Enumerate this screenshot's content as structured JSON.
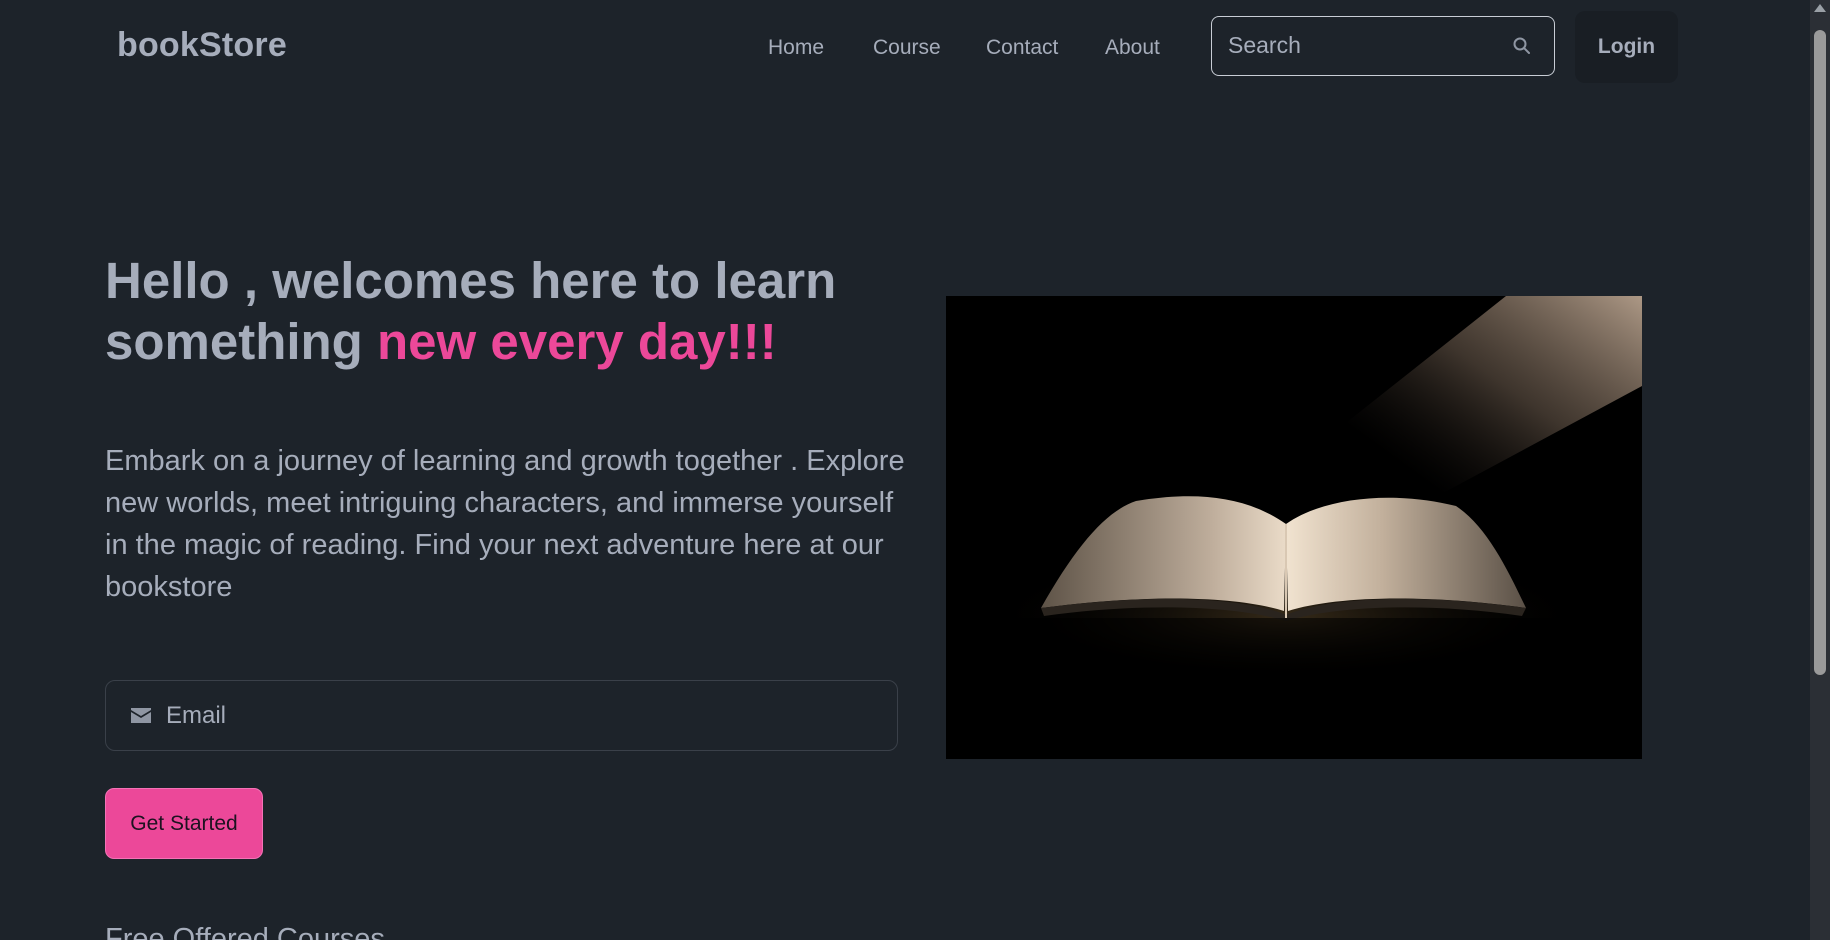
{
  "navbar": {
    "brand": "bookStore",
    "links": [
      {
        "label": "Home"
      },
      {
        "label": "Course"
      },
      {
        "label": "Contact"
      },
      {
        "label": "About"
      }
    ],
    "search": {
      "placeholder": "Search",
      "icon": "search-icon"
    },
    "login_label": "Login"
  },
  "hero": {
    "title_plain": "Hello , welcomes here to learn something ",
    "title_accent": "new every day!!!",
    "description": "Embark on a journey of learning and growth together . Explore new worlds, meet intriguing characters, and immerse yourself in the magic of reading. Find your next adventure here at our bookstore",
    "email": {
      "placeholder": "Email",
      "icon": "envelope-icon"
    },
    "cta_label": "Get Started",
    "image_alt_icon": "open-book-image"
  },
  "next_section": {
    "heading": "Free Offered Courses"
  },
  "colors": {
    "background": "#1d232a",
    "text": "#a6adbb",
    "accent": "#ec4899",
    "login_bg": "#191e24"
  }
}
